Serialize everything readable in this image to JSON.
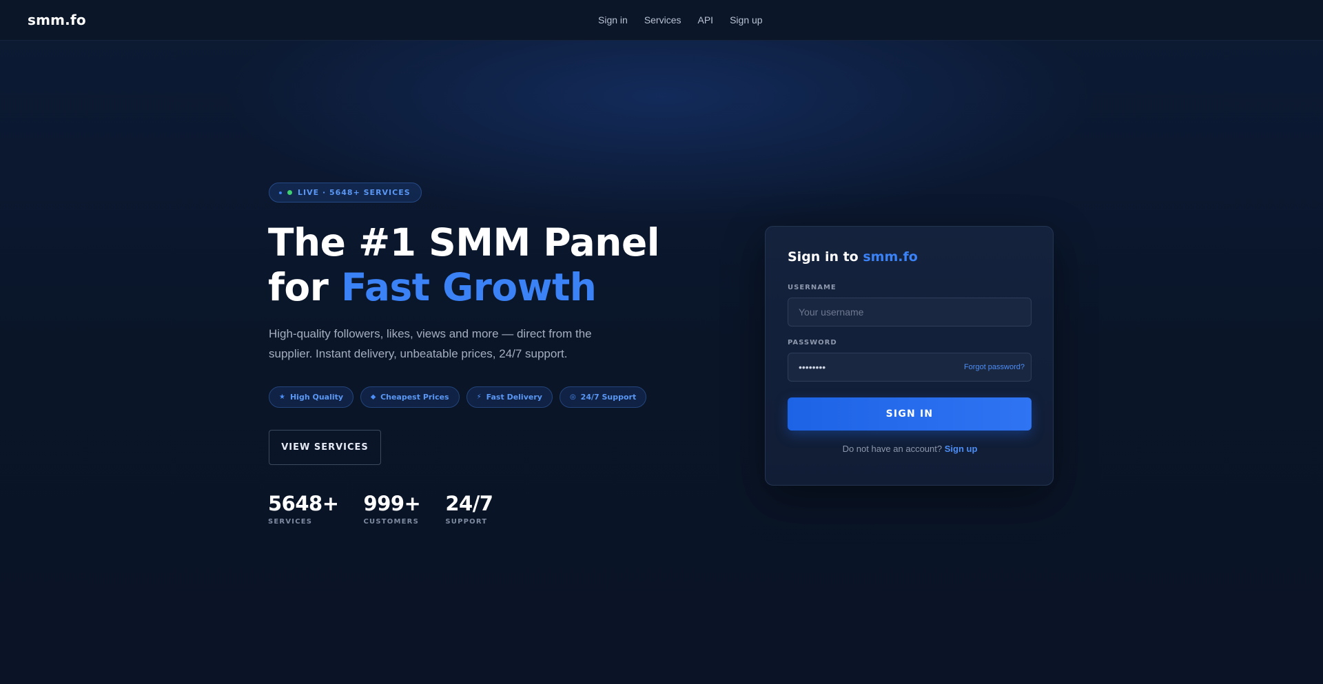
{
  "brand": {
    "name": "smm.fo"
  },
  "nav": {
    "items": [
      {
        "label": "Sign in"
      },
      {
        "label": "Services"
      },
      {
        "label": "API"
      },
      {
        "label": "Sign up"
      }
    ]
  },
  "hero": {
    "badge": "LIVE · 5648+ SERVICES",
    "title_line1": "The #1 SMM Panel",
    "title_line2_prefix": "for ",
    "title_line2_accent": "Fast Growth",
    "subtitle": "High-quality followers, likes, views and more — direct from the supplier. Instant delivery, unbeatable prices, 24/7 support.",
    "features": [
      {
        "icon": "star-icon",
        "glyph": "★",
        "label": "High Quality"
      },
      {
        "icon": "tag-icon",
        "glyph": "⬥",
        "label": "Cheapest Prices"
      },
      {
        "icon": "bolt-icon",
        "glyph": "⚡",
        "label": "Fast Delivery"
      },
      {
        "icon": "support-icon",
        "glyph": "◎",
        "label": "24/7 Support"
      }
    ],
    "cta_label": "VIEW SERVICES",
    "stats": [
      {
        "value": "5648+",
        "label": "SERVICES"
      },
      {
        "value": "999+",
        "label": "CUSTOMERS"
      },
      {
        "value": "24/7",
        "label": "SUPPORT"
      }
    ]
  },
  "login": {
    "title_prefix": "Sign in to ",
    "title_accent": "smm.fo",
    "username_label": "USERNAME",
    "username_placeholder": "Your username",
    "password_label": "PASSWORD",
    "password_value": "••••••••",
    "forgot_label": "Forgot password?",
    "submit_label": "SIGN IN",
    "signup_prompt": "Do not have an account?",
    "signup_link": "Sign up"
  },
  "colors": {
    "background": "#0a1426",
    "accent": "#3b82f6",
    "button": "#1d63e6",
    "live_dot": "#3ecf72"
  }
}
